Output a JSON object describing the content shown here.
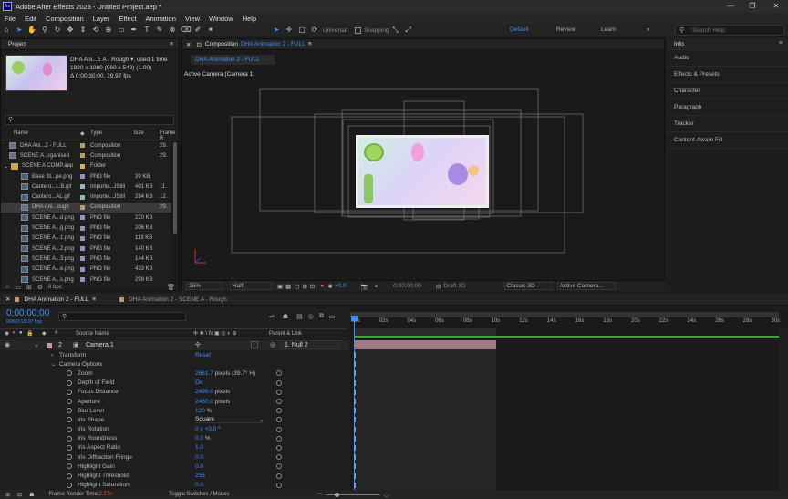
{
  "window": {
    "title": "Adobe After Effects 2023 - Untitled Project.aep *",
    "logo": "Ae"
  },
  "menu": [
    "File",
    "Edit",
    "Composition",
    "Layer",
    "Effect",
    "Animation",
    "View",
    "Window",
    "Help"
  ],
  "toolbar": {
    "universal": "Universal",
    "snapping": "Snapping",
    "workspaces": [
      "Default",
      "Review",
      "Learn"
    ],
    "search_placeholder": "Search Help"
  },
  "project": {
    "tab": "Project",
    "thumb_name": "DHA Ani...E A - Rough",
    "used": ", used 1 time",
    "dims": "1920 x 1080  (960 x 540) (1.00)",
    "duration": "Δ 0;00;30;00, 29.97 fps",
    "search_placeholder": "",
    "columns": {
      "name": "Name",
      "type": "Type",
      "size": "Size",
      "frame": "Frame R"
    },
    "items": [
      {
        "name": "DHA Ani...2 - FULL",
        "type": "Composition",
        "size": "",
        "frame": "29.",
        "kind": "comp",
        "swatch": "#b89c6a",
        "indent": 0
      },
      {
        "name": "SCENE A...rganised",
        "type": "Composition",
        "size": "",
        "frame": "29.",
        "kind": "comp",
        "swatch": "#b89c6a",
        "indent": 0
      },
      {
        "name": "SCENE A COMP.aep",
        "type": "Folder",
        "size": "",
        "frame": "",
        "kind": "folder",
        "swatch": "#d4b25a",
        "indent": 0
      },
      {
        "name": "Base St...pe.png",
        "type": "PNG file",
        "size": "39 KB",
        "frame": "",
        "kind": "file",
        "swatch": "#9a8fc0",
        "indent": 1
      },
      {
        "name": "Cantero...L.B.gif",
        "type": "Importe...JStill",
        "size": "401 KB",
        "frame": "11.",
        "kind": "file",
        "swatch": "#8fb8c0",
        "indent": 1
      },
      {
        "name": "Cantero...AL.gif",
        "type": "Importe...JStill",
        "size": "284 KB",
        "frame": "12.",
        "kind": "file",
        "swatch": "#8fb8c0",
        "indent": 1
      },
      {
        "name": "DHA Ani...ough",
        "type": "Composition",
        "size": "",
        "frame": "29.",
        "kind": "comp",
        "swatch": "#b89c6a",
        "indent": 1,
        "selected": true
      },
      {
        "name": "SCENE A...d.png",
        "type": "PNG file",
        "size": "220 KB",
        "frame": "",
        "kind": "file",
        "swatch": "#9a8fc0",
        "indent": 1
      },
      {
        "name": "SCENE A...g.png",
        "type": "PNG file",
        "size": "206 KB",
        "frame": "",
        "kind": "file",
        "swatch": "#9a8fc0",
        "indent": 1
      },
      {
        "name": "SCENE A...1.png",
        "type": "PNG file",
        "size": "119 KB",
        "frame": "",
        "kind": "file",
        "swatch": "#9a8fc0",
        "indent": 1
      },
      {
        "name": "SCENE A...2.png",
        "type": "PNG file",
        "size": "140 KB",
        "frame": "",
        "kind": "file",
        "swatch": "#9a8fc0",
        "indent": 1
      },
      {
        "name": "SCENE A...3.png",
        "type": "PNG file",
        "size": "144 KB",
        "frame": "",
        "kind": "file",
        "swatch": "#9a8fc0",
        "indent": 1
      },
      {
        "name": "SCENE A...e.png",
        "type": "PNG file",
        "size": "433 KB",
        "frame": "",
        "kind": "file",
        "swatch": "#9a8fc0",
        "indent": 1
      },
      {
        "name": "SCENE A...s.png",
        "type": "PNG file",
        "size": "299 KB",
        "frame": "",
        "kind": "file",
        "swatch": "#9a8fc0",
        "indent": 1
      }
    ],
    "bpc": "8 bpc"
  },
  "composition": {
    "tab_label": "Composition",
    "tab_name": "DHA Animation 2 - FULL",
    "sub_tab": "DHA Animation 2 - FULL",
    "camera_label": "Active Camera (Camera 1)",
    "footer": {
      "zoom": "25%",
      "resolution": "Half",
      "exposure": "+0.0",
      "timecode": "0;00;00;00",
      "draft": "Draft 3D",
      "renderer": "Classic 3D",
      "view": "Active Camera..."
    }
  },
  "right_panel": [
    "Info",
    "Audio",
    "Effects & Presets",
    "Character",
    "Paragraph",
    "Tracker",
    "Content-Aware Fill"
  ],
  "timeline": {
    "tabs": [
      "DHA Animation 2 - FULL",
      "DHA Animation 2 - SCENE A - Rough"
    ],
    "timecode": "0;00;00;00",
    "fps_sub": "00000 (29.97 fps)",
    "search_placeholder": "",
    "columns": {
      "source": "Source Name",
      "parent": "Parent & Link"
    },
    "layer": {
      "num": "2",
      "name": "Camera 1",
      "parent": "1. Null 2"
    },
    "transform": "Transform",
    "transform_reset": "Reset",
    "camera_options": "Camera Options",
    "properties": [
      {
        "name": "Zoom",
        "value": "2661.7",
        "unit": " pixels (39.7° H)"
      },
      {
        "name": "Depth of Field",
        "value": "On",
        "unit": ""
      },
      {
        "name": "Focus Distance",
        "value": "2499.0",
        "unit": " pixels"
      },
      {
        "name": "Aperture",
        "value": "2460.0",
        "unit": " pixels"
      },
      {
        "name": "Blur Level",
        "value": "120",
        "unit": " %"
      },
      {
        "name": "Iris Shape",
        "value": "Square",
        "unit": ""
      },
      {
        "name": "Iris Rotation",
        "value": "0 x +0.0",
        "unit": " °"
      },
      {
        "name": "Iris Roundness",
        "value": "0.0",
        "unit": " %"
      },
      {
        "name": "Iris Aspect Ratio",
        "value": "1.0",
        "unit": ""
      },
      {
        "name": "Iris Diffraction Fringe",
        "value": "0.0",
        "unit": ""
      },
      {
        "name": "Highlight Gain",
        "value": "0.0",
        "unit": ""
      },
      {
        "name": "Highlight Threshold",
        "value": "255",
        "unit": ""
      },
      {
        "name": "Highlight Saturation",
        "value": "0.0",
        "unit": ""
      }
    ],
    "ruler": [
      "00s",
      "02s",
      "04s",
      "06s",
      "08s",
      "10s",
      "12s",
      "14s",
      "16s",
      "18s",
      "20s",
      "22s",
      "24s",
      "26s",
      "28s",
      "30s"
    ],
    "status": {
      "render_label": "Frame Render Time: ",
      "render_value": "2.27s",
      "toggle": "Toggle Switches / Modes"
    }
  },
  "colors": {
    "accent": "#3d8fff",
    "layer_bar": "#a07a84",
    "work_area": "#2ab02a"
  }
}
